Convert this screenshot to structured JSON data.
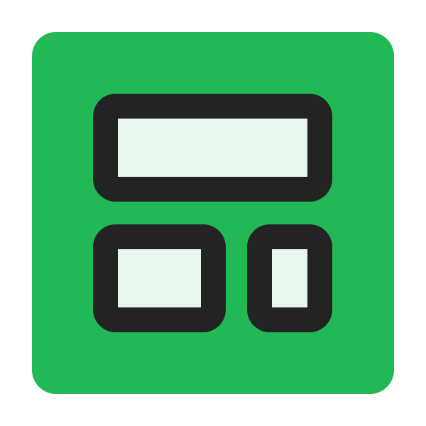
{
  "icon": {
    "name": "layout-dashboard-icon",
    "colors": {
      "background": "#ffffff",
      "tile": "#22b855",
      "outline": "#232323",
      "panel_fill": "#e8f7ee"
    },
    "panels": [
      {
        "name": "layout-panel-top"
      },
      {
        "name": "layout-panel-bottom-left"
      },
      {
        "name": "layout-panel-bottom-right"
      }
    ]
  }
}
